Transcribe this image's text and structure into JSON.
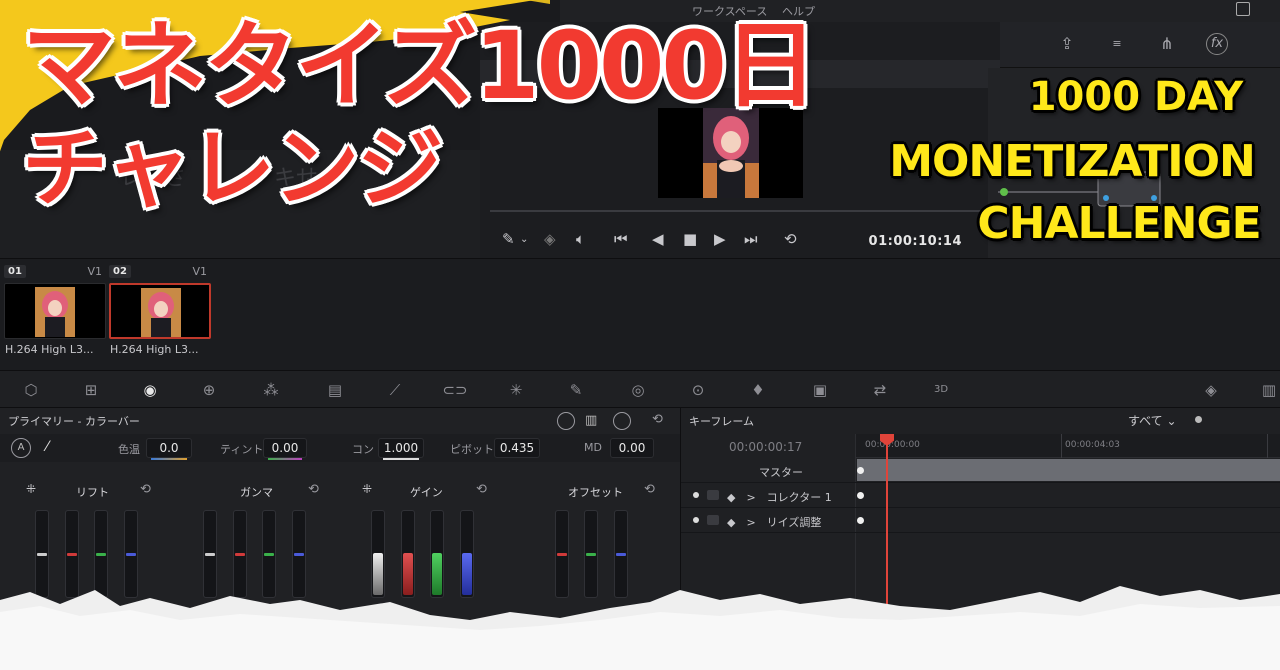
{
  "app": {
    "menus": [
      "ワークスペース",
      "ヘルプ"
    ]
  },
  "headline": {
    "jp_line1": "マネタイズ1000日",
    "jp_line2": "チャレンジ",
    "en_line1": "1000 DAY",
    "en_line2": "MONETIZATION",
    "en_line3": "CHALLENGE",
    "jp_color": "#f23a30",
    "en_color": "#ffe81a"
  },
  "left_panel": {
    "ghost_text": "レ　さ　　　　キせん"
  },
  "viewer": {
    "timecode": "01:00:10:14"
  },
  "clips": [
    {
      "num": "01",
      "track": "V1",
      "caption": "H.264 High L3...",
      "selected": false
    },
    {
      "num": "02",
      "track": "V1",
      "caption": "H.264 High L3...",
      "selected": true
    }
  ],
  "primaries": {
    "title": "プライマリー - カラーバー",
    "params": {
      "temp_label": "色温",
      "temp_value": "0.0",
      "tint_label": "ティント",
      "tint_value": "0.00",
      "contrast_label": "コン",
      "contrast_value": "1.000",
      "pivot_label": "ピボット",
      "pivot_value": "0.435",
      "md_label": "MD",
      "md_value": "0.00"
    },
    "wheels": {
      "lift": "リフト",
      "gamma": "ガンマ",
      "gain": "ゲイン",
      "offset": "オフセット"
    }
  },
  "keyframes": {
    "title": "キーフレーム",
    "filter": "すべて ⌄",
    "timecode": "00:00:00:17",
    "ruler_start": "00:00:00:00",
    "ruler_mid": "00:00:04:03",
    "rows": {
      "master": "マスター",
      "corrector": "◆　>　コレクター 1",
      "resize": "◆　>　リイズ調整"
    }
  }
}
